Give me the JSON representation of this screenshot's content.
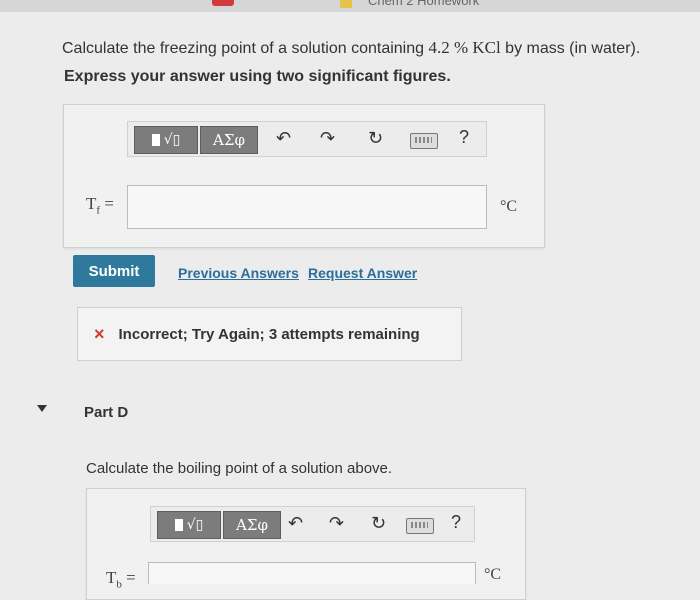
{
  "browser": {
    "tab_fragment": "Chem 2 Homework"
  },
  "partC": {
    "question_prefix": "Calculate the freezing point of a solution containing ",
    "question_amount": "4.2 % KCl",
    "question_suffix": " by mass (in water).",
    "instruction": "Express your answer using two significant figures.",
    "answer_symbol": "T",
    "answer_subscript": "f",
    "answer_equals": "=",
    "answer_value": "",
    "unit": "°C",
    "submit_label": "Submit",
    "previous_answers_label": "Previous Answers",
    "request_answer_label": "Request Answer",
    "feedback_icon": "×",
    "feedback_text": "Incorrect; Try Again; 3 attempts remaining"
  },
  "toolbar": {
    "templates_glyph": "√▯",
    "greek_label": "ΑΣφ",
    "undo_icon": "undo-icon",
    "redo_icon": "redo-icon",
    "reset_icon": "reset-icon",
    "keyboard_icon": "keyboard-icon",
    "help_label": "?"
  },
  "partD": {
    "title": "Part D",
    "question": "Calculate the boiling point of a solution above.",
    "answer_symbol": "T",
    "answer_subscript": "b",
    "answer_equals": "=",
    "answer_value": "",
    "unit": "°C"
  },
  "colors": {
    "submit_bg": "#2f7a9c",
    "link": "#2b6e9b",
    "error": "#d23b2f"
  }
}
